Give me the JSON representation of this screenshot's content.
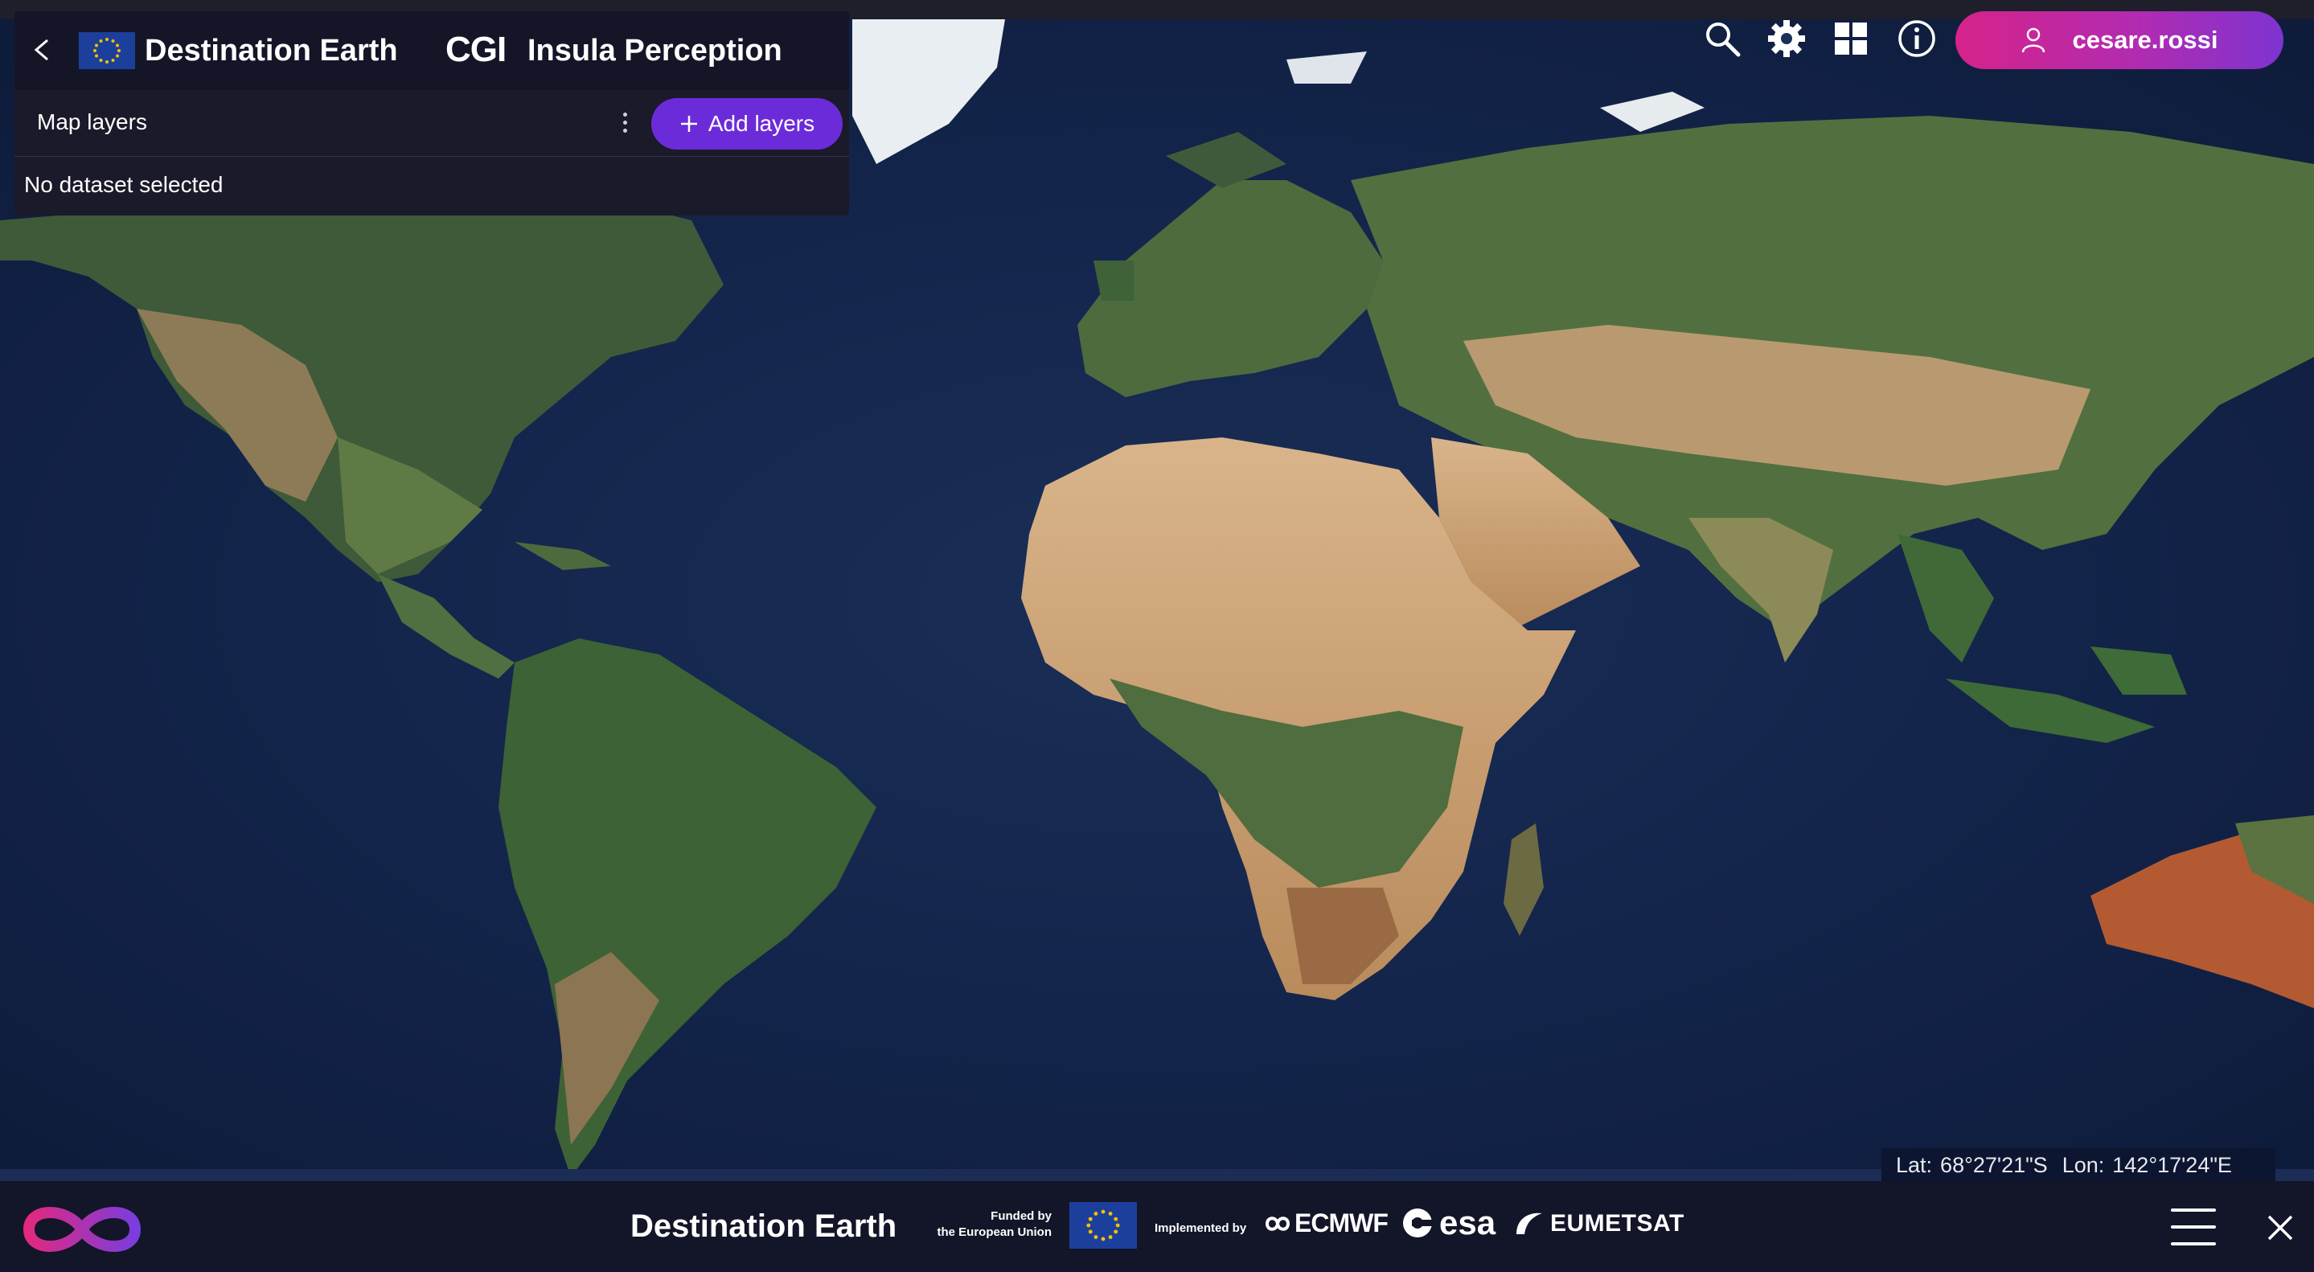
{
  "header": {
    "brand_title": "Destination Earth",
    "cgi_logo_text": "CGI",
    "app_name": "Insula Perception"
  },
  "panel": {
    "layers_title": "Map layers",
    "add_layers_label": "Add layers",
    "empty_state": "No dataset selected"
  },
  "toolbar": {
    "icons": [
      "search-icon",
      "gear-icon",
      "grid-icon",
      "info-icon"
    ],
    "username": "cesare.rossi"
  },
  "coordinates": {
    "lat_label": "Lat:",
    "lat_value": "68°27'21\"S",
    "lon_label": "Lon:",
    "lon_value": "142°17'24\"E"
  },
  "footer": {
    "title": "Destination Earth",
    "funded_line1": "Funded by",
    "funded_line2": "the European Union",
    "implemented_by": "Implemented by",
    "partners": [
      "ECMWF",
      "esa",
      "EUMETSAT"
    ]
  },
  "colors": {
    "accent_purple": "#6c2bd9",
    "user_gradient_start": "#d6238a",
    "user_gradient_end": "#7d34d0",
    "panel_bg": "#1b1a2a",
    "ocean": "#13244a"
  }
}
